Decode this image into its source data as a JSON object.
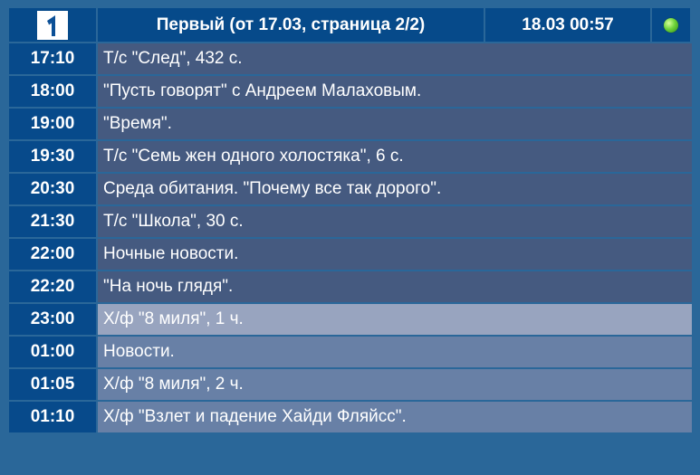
{
  "header": {
    "logo_icon": "channel-one-logo-icon",
    "title": "Первый (от 17.03, страница 2/2)",
    "datetime": "18.03 00:57",
    "status_icon": "green-led-icon"
  },
  "colors": {
    "background": "#2a6799",
    "header_cell": "#064a8a",
    "time_cell": "#074a8b",
    "past_row": "#455a80",
    "current_row": "#98a4bf",
    "future_row": "#6880a6",
    "status_led": "#6fd43b"
  },
  "schedule": [
    {
      "time": "17:10",
      "title": "Т/с \"След\", 432 с.",
      "state": "past"
    },
    {
      "time": "18:00",
      "title": "\"Пусть говорят\" с Андреем Малаховым.",
      "state": "past"
    },
    {
      "time": "19:00",
      "title": "\"Время\".",
      "state": "past"
    },
    {
      "time": "19:30",
      "title": "Т/с \"Семь жен одного холостяка\", 6 с.",
      "state": "past"
    },
    {
      "time": "20:30",
      "title": "Среда обитания. \"Почему все так дорого\".",
      "state": "past"
    },
    {
      "time": "21:30",
      "title": "Т/с \"Школа\", 30 с.",
      "state": "past"
    },
    {
      "time": "22:00",
      "title": "Ночные новости.",
      "state": "past"
    },
    {
      "time": "22:20",
      "title": "\"На ночь глядя\".",
      "state": "past"
    },
    {
      "time": "23:00",
      "title": "Х/ф \"8 миля\", 1 ч.",
      "state": "current"
    },
    {
      "time": "01:00",
      "title": "Новости.",
      "state": "future"
    },
    {
      "time": "01:05",
      "title": "Х/ф \"8 миля\", 2 ч.",
      "state": "future"
    },
    {
      "time": "01:10",
      "title": "Х/ф \"Взлет и падение Хайди Фляйсс\".",
      "state": "future"
    }
  ]
}
